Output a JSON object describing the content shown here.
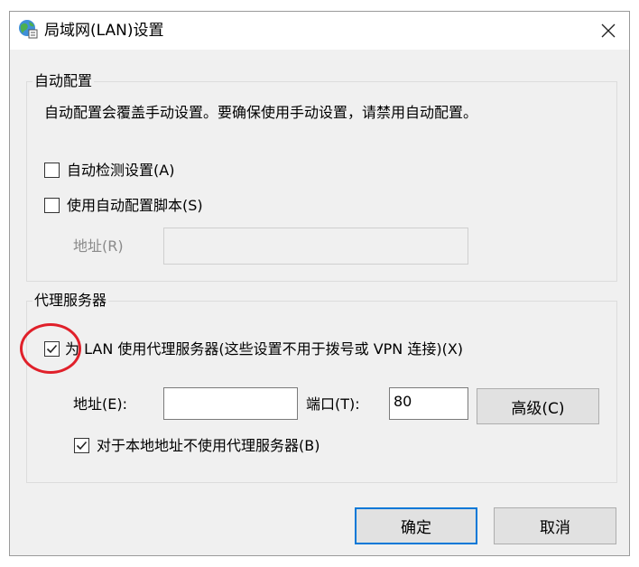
{
  "dialog": {
    "title": "局域网(LAN)设置",
    "icon": "globe-settings-icon"
  },
  "auto_config": {
    "group_title": "自动配置",
    "description": "自动配置会覆盖手动设置。要确保使用手动设置，请禁用自动配置。",
    "auto_detect": {
      "label": "自动检测设置(A)",
      "checked": false
    },
    "use_script": {
      "label": "使用自动配置脚本(S)",
      "checked": false
    },
    "address_label": "地址(R)",
    "address_value": ""
  },
  "proxy": {
    "group_title": "代理服务器",
    "use_proxy": {
      "label": "为 LAN 使用代理服务器(这些设置不用于拨号或 VPN 连接)(X)",
      "checked": true
    },
    "address_label": "地址(E):",
    "address_value": "",
    "port_label": "端口(T):",
    "port_value": "80",
    "advanced_label": "高级(C)",
    "bypass_local": {
      "label": "对于本地地址不使用代理服务器(B)",
      "checked": true
    }
  },
  "buttons": {
    "ok": "确定",
    "cancel": "取消"
  },
  "colors": {
    "accent": "#0078d7",
    "annotation": "#e0202a"
  }
}
